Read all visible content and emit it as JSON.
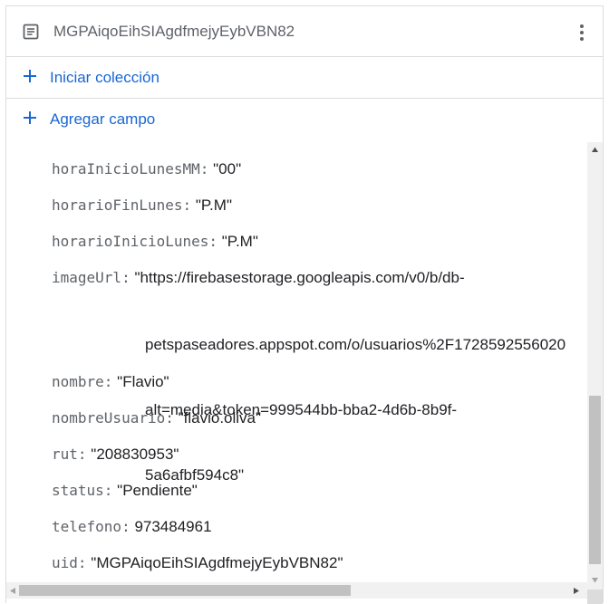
{
  "document": {
    "id": "MGPAiqoEihSIAgdfmejyEybVBN82"
  },
  "actions": {
    "start_collection": "Iniciar colección",
    "add_field": "Agregar campo"
  },
  "fields": [
    {
      "key": "horaInicioLunesMM",
      "sep": ":",
      "value": "\"00\""
    },
    {
      "key": "horarioFinLunes",
      "sep": ":",
      "value": "\"P.M\""
    },
    {
      "key": "horarioInicioLunes",
      "sep": ":",
      "value": "\"P.M\""
    },
    {
      "key": "imageUrl",
      "sep": ":",
      "value": "\"https://firebasestorage.googleapis.com/v0/b/db-"
    },
    {
      "key": "nombre",
      "sep": ":",
      "value": "\"Flavio\""
    },
    {
      "key": "nombreUsuario",
      "sep": ":",
      "value": "\"flavio.oliva\""
    },
    {
      "key": "rut",
      "sep": ":",
      "value": "\"208830953\""
    },
    {
      "key": "status",
      "sep": ":",
      "value": "\"Pendiente\""
    },
    {
      "key": "telefono",
      "sep": ":",
      "value": "973484961"
    },
    {
      "key": "uid",
      "sep": ":",
      "value": "\"MGPAiqoEihSIAgdfmejyEybVBN82\""
    }
  ],
  "image_url_continuation": [
    "petspaseadores.appspot.com/o/usuarios%2F1728592556020",
    "alt=media&token=999544bb-bba2-4d6b-8b9f-",
    "5a6afbf594c8\""
  ],
  "colors": {
    "accent": "#1967d2",
    "key_text": "#5f6368",
    "value_text": "#202124",
    "divider": "#dadce0"
  }
}
